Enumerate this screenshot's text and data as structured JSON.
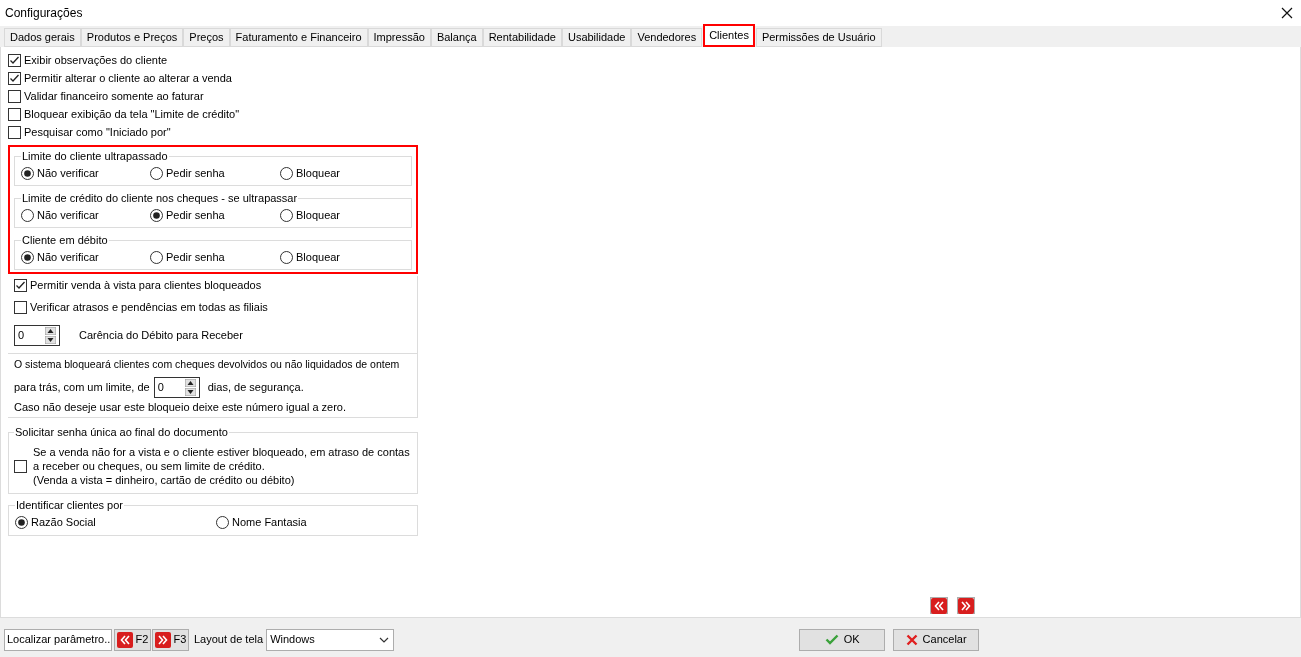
{
  "window": {
    "title": "Configurações"
  },
  "tabs": [
    {
      "label": "Dados gerais",
      "selected": false
    },
    {
      "label": "Produtos e Preços",
      "selected": false
    },
    {
      "label": "Preços",
      "selected": false
    },
    {
      "label": "Faturamento e Financeiro",
      "selected": false
    },
    {
      "label": "Impressão",
      "selected": false
    },
    {
      "label": "Balança",
      "selected": false
    },
    {
      "label": "Rentabilidade",
      "selected": false
    },
    {
      "label": "Usabilidade",
      "selected": false
    },
    {
      "label": "Vendedores",
      "selected": false
    },
    {
      "label": "Clientes",
      "selected": true
    },
    {
      "label": "Permissões de Usuário",
      "selected": false
    }
  ],
  "options": [
    {
      "label": "Exibir observações do cliente",
      "checked": true
    },
    {
      "label": "Permitir alterar o cliente ao alterar a venda",
      "checked": true
    },
    {
      "label": "Validar financeiro somente ao faturar",
      "checked": false
    },
    {
      "label": "Bloquear exibição da tela \"Limite de crédito\"",
      "checked": false
    },
    {
      "label": "Pesquisar como \"Iniciado por\"",
      "checked": false
    }
  ],
  "radio_groups": [
    {
      "title": "Limite do cliente ultrapassado",
      "options": [
        {
          "label": "Não verificar",
          "selected": true
        },
        {
          "label": "Pedir senha",
          "selected": false
        },
        {
          "label": "Bloquear",
          "selected": false
        }
      ]
    },
    {
      "title": "Limite de crédito do cliente nos cheques - se ultrapassar",
      "options": [
        {
          "label": "Não verificar",
          "selected": false
        },
        {
          "label": "Pedir senha",
          "selected": true
        },
        {
          "label": "Bloquear",
          "selected": false
        }
      ]
    },
    {
      "title": "Cliente em débito",
      "options": [
        {
          "label": "Não verificar",
          "selected": true
        },
        {
          "label": "Pedir senha",
          "selected": false
        },
        {
          "label": "Bloquear",
          "selected": false
        }
      ]
    }
  ],
  "more_options": [
    {
      "label": "Permitir venda à vista para clientes bloqueados",
      "checked": true
    },
    {
      "label": "Verificar atrasos e pendências em todas as filiais",
      "checked": false
    }
  ],
  "grace_period": {
    "value": "0",
    "label": "Carência do Débito para Receber"
  },
  "cheque_block": {
    "line_1": "O sistema bloqueará clientes com cheques devolvidos ou não liquidados de ontem",
    "prefix": "para trás, com um limite, de",
    "value": "0",
    "suffix": "dias, de segurança.",
    "note": "Caso não deseje usar este bloqueio deixe este número igual a zero."
  },
  "single_password": {
    "title": "Solicitar senha única ao final do documento",
    "checked": false,
    "lines": [
      "Se a venda não for a vista e o cliente estiver bloqueado, em atraso de contas",
      "a receber ou cheques, ou sem limite de crédito.",
      "(Venda a vista = dinheiro, cartão de crédito ou débito)"
    ]
  },
  "identify_by": {
    "title": "Identificar clientes por",
    "options": [
      {
        "label": "Razão Social",
        "selected": true
      },
      {
        "label": "Nome Fantasia",
        "selected": false
      }
    ]
  },
  "footer": {
    "search_button": "Localizar parâmetro..",
    "prev_key": "F2",
    "next_key": "F3",
    "layout_label": "Layout de tela",
    "layout_value": "Windows",
    "ok": "OK",
    "cancel": "Cancelar"
  }
}
